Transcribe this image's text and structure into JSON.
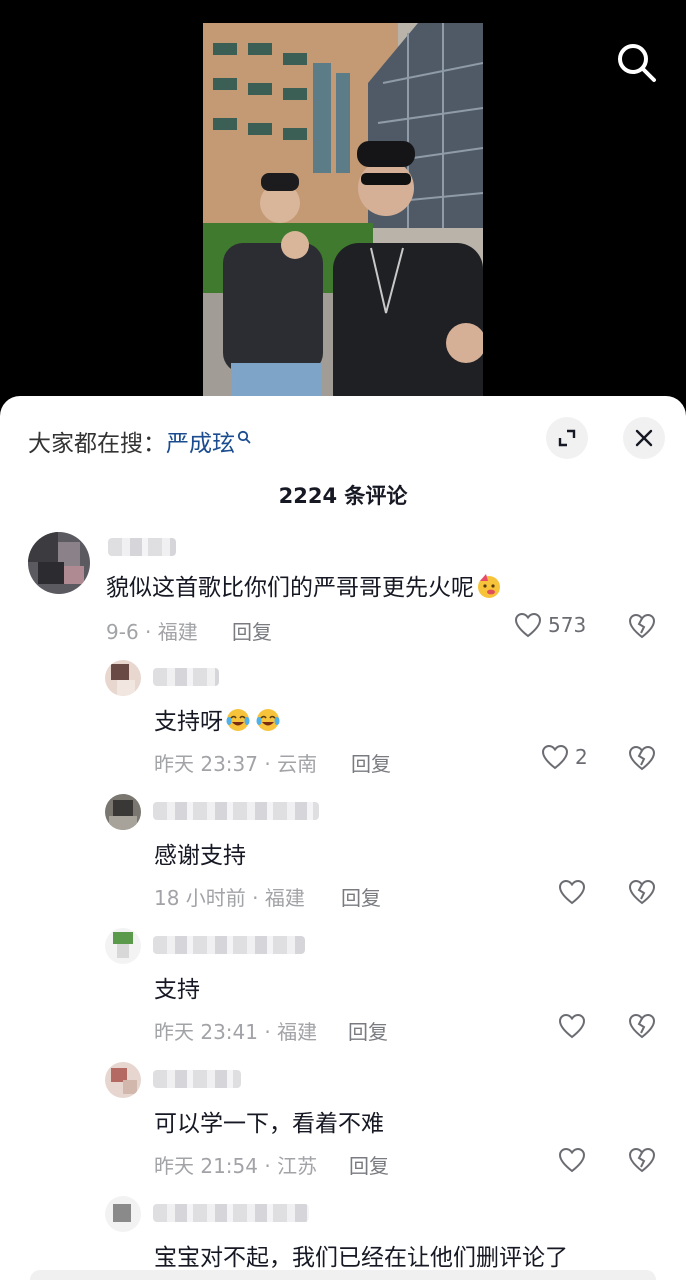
{
  "hot_search": {
    "prefix": "大家都在搜：",
    "keyword": "严成玹"
  },
  "comment_count_label": "2224 条评论",
  "comments": [
    {
      "text": "貌似这首歌比你们的严哥哥更先火呢",
      "emoji": "party-face",
      "meta": "9-6 · 福建",
      "reply_label": "回复",
      "likes": "573"
    }
  ],
  "replies": [
    {
      "text": "支持呀",
      "emojis": [
        "tears-of-joy",
        "tears-of-joy"
      ],
      "meta": "昨天 23:37 · 云南",
      "reply_label": "回复",
      "likes": "2"
    },
    {
      "text": "感谢支持",
      "meta": "18 小时前 · 福建",
      "reply_label": "回复",
      "likes": ""
    },
    {
      "text": "支持",
      "meta": "昨天 23:41 · 福建",
      "reply_label": "回复",
      "likes": ""
    },
    {
      "text": "可以学一下，看着不难",
      "meta": "昨天 21:54 · 江苏",
      "reply_label": "回复",
      "likes": ""
    },
    {
      "text": "宝宝对不起，我们已经在让他们删评论了"
    }
  ],
  "icons": {
    "search": "search-icon",
    "keyword_search": "search-small-icon",
    "expand": "expand-icon",
    "close": "close-icon",
    "like": "heart-outline-icon",
    "dislike": "broken-heart-icon"
  },
  "colors": {
    "keyword": "#1a4c8f",
    "meta": "#a2a3a7",
    "text": "#161823",
    "sheet_bg": "#ffffff"
  }
}
